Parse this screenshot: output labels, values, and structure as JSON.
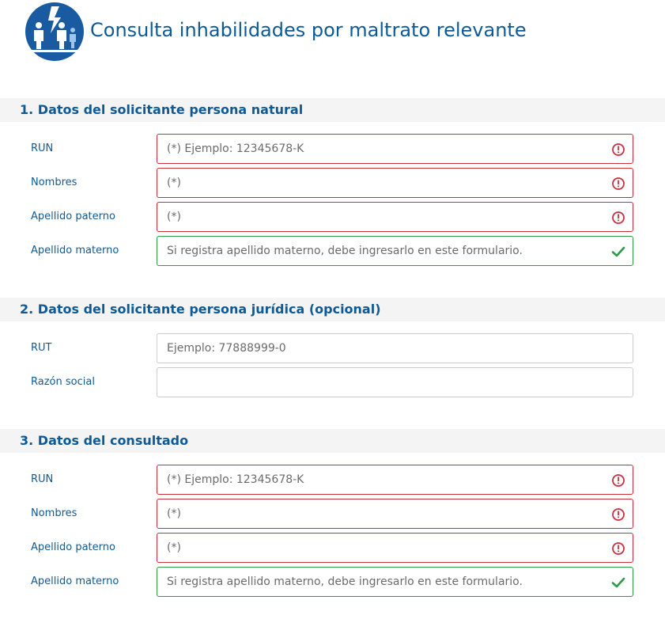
{
  "header": {
    "title": "Consulta inhabilidades por maltrato relevante",
    "logo_icon": "family-protection-logo-icon",
    "brand_color": "#1a5aa0"
  },
  "sections": [
    {
      "title": "1. Datos del solicitante persona natural",
      "fields": [
        {
          "label": "RUN",
          "placeholder": "(*) Ejemplo: 12345678-K",
          "value": "",
          "state": "invalid"
        },
        {
          "label": "Nombres",
          "placeholder": "(*)",
          "value": "",
          "state": "invalid"
        },
        {
          "label": "Apellido paterno",
          "placeholder": "(*)",
          "value": "",
          "state": "invalid"
        },
        {
          "label": "Apellido materno",
          "placeholder": "Si registra apellido materno, debe ingresarlo en este formulario.",
          "value": "",
          "state": "valid"
        }
      ]
    },
    {
      "title": "2. Datos del solicitante persona jurídica (opcional)",
      "fields": [
        {
          "label": "RUT",
          "placeholder": "Ejemplo: 77888999-0",
          "value": "",
          "state": "neutral"
        },
        {
          "label": "Razón social",
          "placeholder": "",
          "value": "",
          "state": "neutral"
        }
      ]
    },
    {
      "title": "3. Datos del consultado",
      "fields": [
        {
          "label": "RUN",
          "placeholder": "(*) Ejemplo: 12345678-K",
          "value": "",
          "state": "invalid"
        },
        {
          "label": "Nombres",
          "placeholder": "(*)",
          "value": "",
          "state": "invalid"
        },
        {
          "label": "Apellido paterno",
          "placeholder": "(*)",
          "value": "",
          "state": "invalid"
        },
        {
          "label": "Apellido materno",
          "placeholder": "Si registra apellido materno, debe ingresarlo en este formulario.",
          "value": "",
          "state": "valid"
        }
      ]
    }
  ],
  "colors": {
    "invalid": "#c9303e",
    "valid": "#2e9b47",
    "label": "#0e5a97",
    "section_bg": "#f4f4f4"
  },
  "icons": {
    "invalid": "exclamation-circle-icon",
    "valid": "checkmark-icon"
  }
}
